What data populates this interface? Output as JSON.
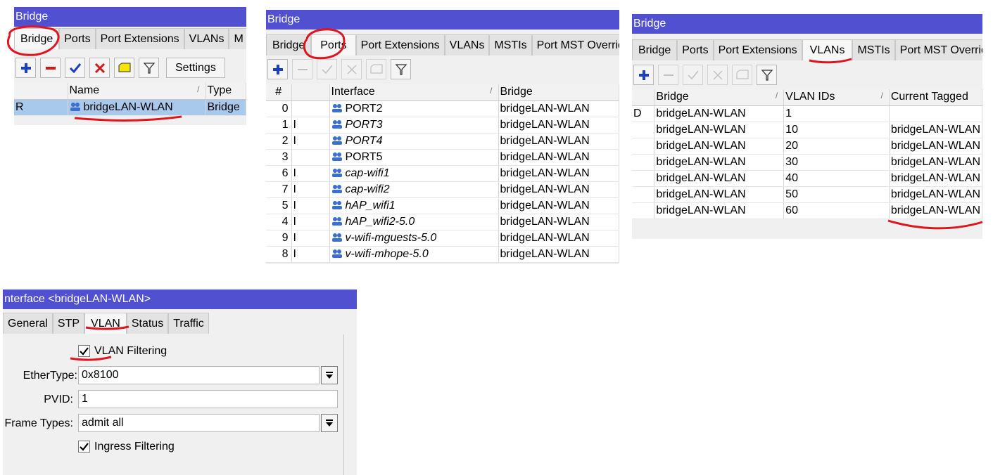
{
  "panel1": {
    "title": "Bridge",
    "tabs": [
      "Bridge",
      "Ports",
      "Port Extensions",
      "VLANs",
      "M"
    ],
    "toolbar": {
      "settings_label": "Settings"
    },
    "columns": [
      "",
      "Name",
      "Type"
    ],
    "rows": [
      {
        "flag": "R",
        "name": "bridgeLAN-WLAN",
        "type": "Bridge"
      }
    ]
  },
  "panel2": {
    "title": "Bridge",
    "tabs": [
      "Bridge",
      "Ports",
      "Port Extensions",
      "VLANs",
      "MSTIs",
      "Port MST Override"
    ],
    "columns": [
      "#",
      "",
      "Interface",
      "Bridge"
    ],
    "rows": [
      {
        "num": "0",
        "flag": "",
        "iface": "PORT2",
        "italic": false,
        "bridge": "bridgeLAN-WLAN"
      },
      {
        "num": "1",
        "flag": "I",
        "iface": "PORT3",
        "italic": true,
        "bridge": "bridgeLAN-WLAN"
      },
      {
        "num": "2",
        "flag": "I",
        "iface": "PORT4",
        "italic": true,
        "bridge": "bridgeLAN-WLAN"
      },
      {
        "num": "3",
        "flag": "",
        "iface": "PORT5",
        "italic": false,
        "bridge": "bridgeLAN-WLAN"
      },
      {
        "num": "6",
        "flag": "I",
        "iface": "cap-wifi1",
        "italic": true,
        "bridge": "bridgeLAN-WLAN"
      },
      {
        "num": "7",
        "flag": "I",
        "iface": "cap-wifi2",
        "italic": true,
        "bridge": "bridgeLAN-WLAN"
      },
      {
        "num": "5",
        "flag": "I",
        "iface": "hAP_wifi1",
        "italic": true,
        "bridge": "bridgeLAN-WLAN"
      },
      {
        "num": "4",
        "flag": "I",
        "iface": "hAP_wifi2-5.0",
        "italic": true,
        "bridge": "bridgeLAN-WLAN"
      },
      {
        "num": "9",
        "flag": "I",
        "iface": "v-wifi-mguests-5.0",
        "italic": true,
        "bridge": "bridgeLAN-WLAN"
      },
      {
        "num": "8",
        "flag": "I",
        "iface": "v-wifi-mhope-5.0",
        "italic": true,
        "bridge": "bridgeLAN-WLAN"
      }
    ]
  },
  "panel3": {
    "title": "Bridge",
    "tabs": [
      "Bridge",
      "Ports",
      "Port Extensions",
      "VLANs",
      "MSTIs",
      "Port MST Overrid"
    ],
    "columns": [
      "",
      "Bridge",
      "VLAN IDs",
      "Current Tagged"
    ],
    "rows": [
      {
        "flag": "D",
        "bridge": "bridgeLAN-WLAN",
        "vlan": "1",
        "tagged": ""
      },
      {
        "flag": "",
        "bridge": "bridgeLAN-WLAN",
        "vlan": "10",
        "tagged": "bridgeLAN-WLAN"
      },
      {
        "flag": "",
        "bridge": "bridgeLAN-WLAN",
        "vlan": "20",
        "tagged": "bridgeLAN-WLAN"
      },
      {
        "flag": "",
        "bridge": "bridgeLAN-WLAN",
        "vlan": "30",
        "tagged": "bridgeLAN-WLAN"
      },
      {
        "flag": "",
        "bridge": "bridgeLAN-WLAN",
        "vlan": "40",
        "tagged": "bridgeLAN-WLAN"
      },
      {
        "flag": "",
        "bridge": "bridgeLAN-WLAN",
        "vlan": "50",
        "tagged": "bridgeLAN-WLAN"
      },
      {
        "flag": "",
        "bridge": "bridgeLAN-WLAN",
        "vlan": "60",
        "tagged": "bridgeLAN-WLAN"
      }
    ]
  },
  "panel4": {
    "title": "nterface <bridgeLAN-WLAN>",
    "tabs": [
      "General",
      "STP",
      "VLAN",
      "Status",
      "Traffic"
    ],
    "vlan_filtering_label": "VLAN Filtering",
    "vlan_filtering_checked": true,
    "ethertype_label": "EtherType:",
    "ethertype_value": "0x8100",
    "pvid_label": "PVID:",
    "pvid_value": "1",
    "frame_types_label": "Frame Types:",
    "frame_types_value": "admit all",
    "ingress_filtering_label": "Ingress Filtering",
    "ingress_filtering_checked": true
  },
  "colors": {
    "titlebar": "#5050d0",
    "annotation": "#e0141e",
    "selected_row": "#a8c8ec",
    "add_icon": "#1a3fc7",
    "remove_icon": "#d01818"
  },
  "icons": [
    "add-icon",
    "remove-icon",
    "enable-icon",
    "disable-icon",
    "comment-icon",
    "filter-icon",
    "interface-icon",
    "checkbox-check-icon",
    "dropdown-arrow-icon"
  ]
}
